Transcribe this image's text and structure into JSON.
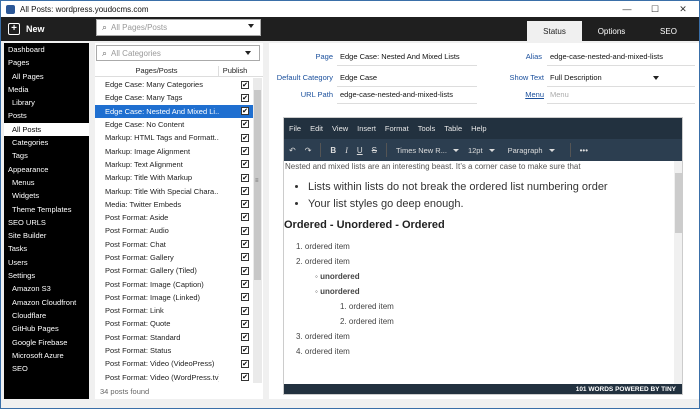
{
  "window": {
    "title": "All Posts: wordpress.youdocms.com",
    "minimize": "—",
    "maximize": "☐",
    "close": "✕"
  },
  "topbar": {
    "new_label": "New",
    "page_search_placeholder": "All Pages/Posts",
    "tabs": [
      {
        "label": "Status"
      },
      {
        "label": "Options"
      },
      {
        "label": "SEO"
      }
    ]
  },
  "sidebar": {
    "items": [
      {
        "label": "Dashboard"
      },
      {
        "label": "Pages"
      },
      {
        "label": "All Pages"
      },
      {
        "label": "Media"
      },
      {
        "label": "Library"
      },
      {
        "label": "Posts"
      },
      {
        "label": "All Posts"
      },
      {
        "label": "Categories"
      },
      {
        "label": "Tags"
      },
      {
        "label": "Appearance"
      },
      {
        "label": "Menus"
      },
      {
        "label": "Widgets"
      },
      {
        "label": "Theme Templates"
      },
      {
        "label": "SEO URLS"
      },
      {
        "label": "Site Builder"
      },
      {
        "label": "Tasks"
      },
      {
        "label": "Users"
      },
      {
        "label": "Settings"
      },
      {
        "label": "Amazon S3"
      },
      {
        "label": "Amazon Cloudfront"
      },
      {
        "label": "Cloudflare"
      },
      {
        "label": "GitHub Pages"
      },
      {
        "label": "Google Firebase"
      },
      {
        "label": "Microsoft Azure"
      },
      {
        "label": "SEO"
      }
    ]
  },
  "list": {
    "category_placeholder": "All Categories",
    "col_pages": "Pages/Posts",
    "col_publish": "Publish",
    "check": "✔",
    "count_text": "34 posts found",
    "rows": [
      {
        "title": "Edge Case: Many Categories"
      },
      {
        "title": "Edge Case: Many Tags"
      },
      {
        "title": "Edge Case: Nested And Mixed Li..."
      },
      {
        "title": "Edge Case: No Content"
      },
      {
        "title": "Markup: HTML Tags and Formatt..."
      },
      {
        "title": "Markup: Image Alignment"
      },
      {
        "title": "Markup: Text Alignment"
      },
      {
        "title": "Markup: Title With Markup"
      },
      {
        "title": "Markup: Title With Special Chara..."
      },
      {
        "title": "Media: Twitter Embeds"
      },
      {
        "title": "Post Format: Aside"
      },
      {
        "title": "Post Format: Audio"
      },
      {
        "title": "Post Format: Chat"
      },
      {
        "title": "Post Format: Gallery"
      },
      {
        "title": "Post Format: Gallery (Tiled)"
      },
      {
        "title": "Post Format: Image (Caption)"
      },
      {
        "title": "Post Format: Image (Linked)"
      },
      {
        "title": "Post Format: Link"
      },
      {
        "title": "Post Format: Quote"
      },
      {
        "title": "Post Format: Standard"
      },
      {
        "title": "Post Format: Status"
      },
      {
        "title": "Post Format: Video (VideoPress)"
      },
      {
        "title": "Post Format: Video (WordPress.tv)"
      }
    ]
  },
  "form": {
    "page_label": "Page",
    "page_value": "Edge Case: Nested And Mixed Lists",
    "alias_label": "Alias",
    "alias_value": "edge-case-nested-and-mixed-lists",
    "category_label": "Default Category",
    "category_value": "Edge Case",
    "show_text_label": "Show Text",
    "show_text_value": "Full Description",
    "url_label": "URL Path",
    "url_value": "edge-case-nested-and-mixed-lists",
    "menu_label": "Menu",
    "menu_placeholder": "Menu"
  },
  "editor": {
    "menus": [
      "File",
      "Edit",
      "View",
      "Insert",
      "Format",
      "Tools",
      "Table",
      "Help"
    ],
    "font": "Times New R...",
    "size": "12pt",
    "block": "Paragraph",
    "intro": "Nested and mixed lists are an interesting beast. It’s a corner case to make sure that",
    "bullets": [
      "Lists within lists do not break the ordered list numbering order",
      "Your list styles go deep enough."
    ],
    "heading": "Ordered - Unordered - Ordered",
    "ol": {
      "item1": "1. ordered item",
      "item2": "2. ordered item",
      "unordered1": "unordered",
      "unordered2": "unordered",
      "nested1": "1. ordered item",
      "nested2": "2. ordered item",
      "item3": "3. ordered item",
      "item4": "4. ordered item"
    },
    "status": "101 WORDS  POWERED BY TINY"
  }
}
